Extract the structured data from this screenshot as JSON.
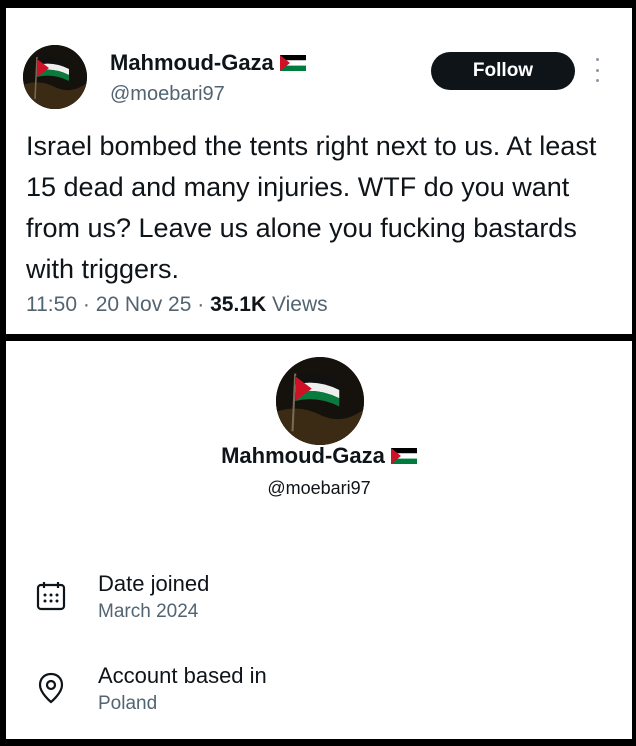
{
  "tweet": {
    "display_name": "Mahmoud-Gaza",
    "handle": "@moebari97",
    "follow_label": "Follow",
    "text": "Israel bombed the tents right next to us. At least 15 dead and many injuries. WTF do you want from us? Leave us alone you fucking bastards with triggers.",
    "time": "11:50",
    "date": "20 Nov 25",
    "views_count": "35.1K",
    "views_label": "Views",
    "separator": "·"
  },
  "profile": {
    "display_name": "Mahmoud-Gaza",
    "handle": "@moebari97",
    "date_joined_label": "Date joined",
    "date_joined_value": "March 2024",
    "account_based_label": "Account based in",
    "account_based_value": "Poland"
  },
  "icons": {
    "flag": "palestine-flag-icon",
    "more": "more-vertical-icon",
    "calendar": "calendar-icon",
    "location": "location-pin-icon"
  },
  "colors": {
    "text_primary": "#0f1419",
    "text_secondary": "#536471",
    "follow_bg": "#0f1419",
    "flag_red": "#ce1126",
    "flag_green": "#007a3d"
  }
}
